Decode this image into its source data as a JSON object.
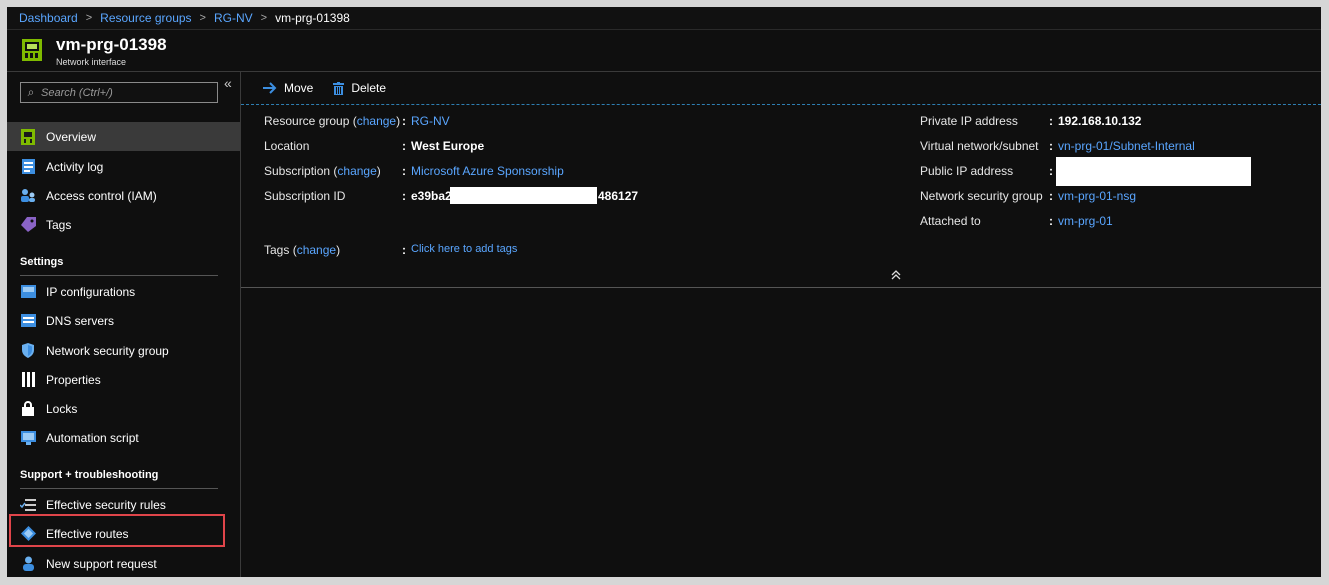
{
  "breadcrumb": {
    "items": [
      "Dashboard",
      "Resource groups",
      "RG-NV"
    ],
    "current": "vm-prg-01398",
    "separator": ">"
  },
  "header": {
    "title": "vm-prg-01398",
    "subtitle": "Network interface",
    "icon": "network-interface-icon"
  },
  "sidebar": {
    "search_placeholder": "Search (Ctrl+/)",
    "collapse_glyph": "«",
    "items": [
      {
        "label": "Overview",
        "icon": "overview-icon"
      },
      {
        "label": "Activity log",
        "icon": "activity-log-icon"
      },
      {
        "label": "Access control (IAM)",
        "icon": "iam-icon"
      },
      {
        "label": "Tags",
        "icon": "tag-icon"
      }
    ],
    "settings_label": "Settings",
    "settings_items": [
      {
        "label": "IP configurations",
        "icon": "ip-config-icon"
      },
      {
        "label": "DNS servers",
        "icon": "dns-icon"
      },
      {
        "label": "Network security group",
        "icon": "shield-icon"
      },
      {
        "label": "Properties",
        "icon": "properties-icon"
      },
      {
        "label": "Locks",
        "icon": "lock-icon"
      },
      {
        "label": "Automation script",
        "icon": "automation-icon"
      }
    ],
    "support_label": "Support + troubleshooting",
    "support_items": [
      {
        "label": "Effective security rules",
        "icon": "security-rules-icon"
      },
      {
        "label": "Effective routes",
        "icon": "routes-icon"
      },
      {
        "label": "New support request",
        "icon": "support-icon"
      }
    ]
  },
  "toolbar": {
    "move_label": "Move",
    "delete_label": "Delete"
  },
  "essentials": {
    "change_label": "change",
    "left": {
      "resource_group_label": "Resource group",
      "resource_group_value": "RG-NV",
      "location_label": "Location",
      "location_value": "West Europe",
      "subscription_label": "Subscription",
      "subscription_value": "Microsoft Azure Sponsorship",
      "subscription_id_label": "Subscription ID",
      "subscription_id_prefix": "e39ba2",
      "subscription_id_suffix": "486127",
      "tags_label": "Tags",
      "tags_value": "Click here to add tags"
    },
    "right": {
      "private_ip_label": "Private IP address",
      "private_ip_value": "192.168.10.132",
      "vnet_label": "Virtual network/subnet",
      "vnet_value": "vn-prg-01/Subnet-Internal",
      "public_ip_label": "Public IP address",
      "nsg_label": "Network security group",
      "nsg_value": "vm-prg-01-nsg",
      "attached_label": "Attached to",
      "attached_value": "vm-prg-01"
    },
    "collapse_glyph": "⌃"
  },
  "colors": {
    "accent": "#5aa6ff",
    "highlight": "#e0454a",
    "background": "#0f0f0f"
  }
}
